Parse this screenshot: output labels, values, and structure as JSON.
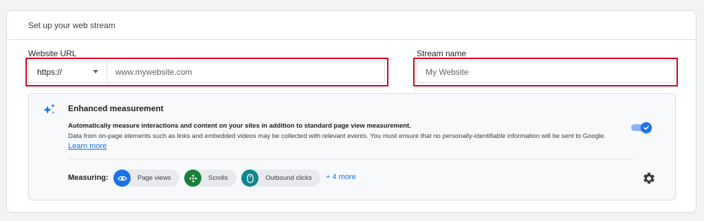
{
  "header": {
    "title": "Set up your web stream"
  },
  "website_url": {
    "label": "Website URL",
    "protocol": "https://",
    "placeholder": "www.mywebsite.com"
  },
  "stream_name": {
    "label": "Stream name",
    "placeholder": "My Website"
  },
  "enhanced": {
    "title": "Enhanced measurement",
    "description_bold": "Automatically measure interactions and content on your sites in addition to standard page view measurement.",
    "description": "Data from on-page elements such as links and embedded videos may be collected with relevant events. You must ensure that no personally-identifiable information will be sent to Google.",
    "learn_more": "Learn more",
    "toggle_on": true
  },
  "measuring": {
    "label": "Measuring:",
    "chips": [
      {
        "label": "Page views",
        "icon": "eye-icon",
        "color": "#1a73e8"
      },
      {
        "label": "Scrolls",
        "icon": "crosshair-icon",
        "color": "#188038"
      },
      {
        "label": "Outbound clicks",
        "icon": "mouse-icon",
        "color": "#12858f"
      }
    ],
    "more": "+ 4 more"
  },
  "colors": {
    "accent": "#1a73e8",
    "highlight": "#d0021b"
  }
}
